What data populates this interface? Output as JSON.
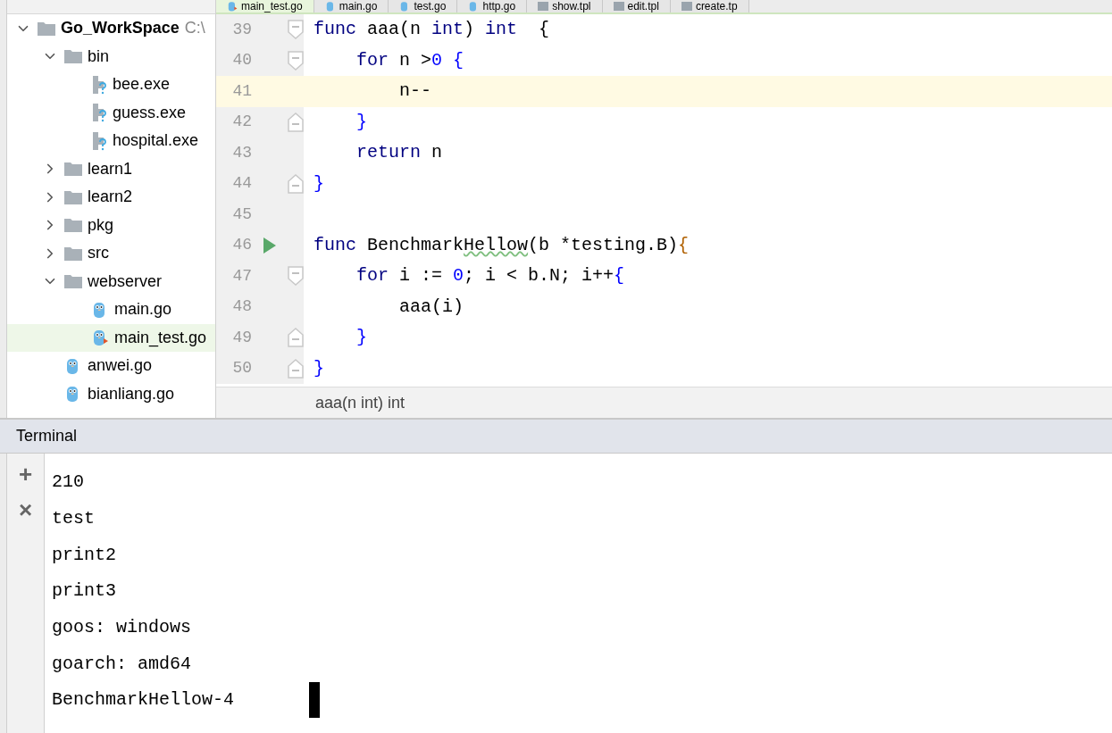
{
  "editor_tabs": [
    {
      "label": "main_test.go",
      "kind": "go_test",
      "selected": true
    },
    {
      "label": "main.go",
      "kind": "go",
      "selected": false
    },
    {
      "label": "test.go",
      "kind": "go",
      "selected": false
    },
    {
      "label": "http.go",
      "kind": "go",
      "selected": false
    },
    {
      "label": "show.tpl",
      "kind": "tpl",
      "selected": false
    },
    {
      "label": "edit.tpl",
      "kind": "tpl",
      "selected": false
    },
    {
      "label": "create.tp",
      "kind": "tpl",
      "selected": false
    }
  ],
  "project_tree": [
    {
      "label": "Go_WorkSpace",
      "path": "C:\\",
      "kind": "folder",
      "expanded": true,
      "selected": false,
      "children": [
        {
          "label": "bin",
          "kind": "folder",
          "expanded": true,
          "selected": false,
          "children": [
            {
              "label": "bee.exe",
              "kind": "exe",
              "selected": false
            },
            {
              "label": "guess.exe",
              "kind": "exe",
              "selected": false
            },
            {
              "label": "hospital.exe",
              "kind": "exe",
              "selected": false
            }
          ]
        },
        {
          "label": "learn1",
          "kind": "folder",
          "expanded": false,
          "selected": false
        },
        {
          "label": "learn2",
          "kind": "folder",
          "expanded": false,
          "selected": false
        },
        {
          "label": "pkg",
          "kind": "folder",
          "expanded": false,
          "selected": false
        },
        {
          "label": "src",
          "kind": "folder",
          "expanded": false,
          "selected": false
        },
        {
          "label": "webserver",
          "kind": "folder",
          "expanded": true,
          "selected": false,
          "children": [
            {
              "label": "main.go",
              "kind": "go",
              "selected": false
            },
            {
              "label": "main_test.go",
              "kind": "go_test",
              "selected": true
            }
          ]
        },
        {
          "label": "anwei.go",
          "kind": "go",
          "selected": false
        },
        {
          "label": "bianliang.go",
          "kind": "go",
          "selected": false
        }
      ]
    }
  ],
  "code_lines": [
    {
      "number": "39",
      "current": false,
      "run": false,
      "kind": "fold_start",
      "tokens": [
        {
          "t": "func",
          "kind": "keyword"
        },
        {
          "t": " aaa(n ",
          "kind": "plain"
        },
        {
          "t": "int",
          "kind": "keyword"
        },
        {
          "t": ") ",
          "kind": "plain"
        },
        {
          "t": "int",
          "kind": "keyword"
        },
        {
          "t": "  {",
          "kind": "plain"
        }
      ]
    },
    {
      "number": "40",
      "current": false,
      "run": false,
      "kind": "fold_start",
      "tokens": [
        {
          "t": "    for",
          "kind": "keyword"
        },
        {
          "t": " n >",
          "kind": "plain"
        },
        {
          "t": "0",
          "kind": "number"
        },
        {
          "t": " {",
          "kind": "number"
        }
      ]
    },
    {
      "number": "41",
      "current": true,
      "run": false,
      "kind": "plain",
      "tokens": [
        {
          "t": "        n--",
          "kind": "plain"
        }
      ]
    },
    {
      "number": "42",
      "current": false,
      "run": false,
      "kind": "fold_end",
      "tokens": [
        {
          "t": "    }",
          "kind": "number"
        }
      ]
    },
    {
      "number": "43",
      "current": false,
      "run": false,
      "kind": "plain",
      "tokens": [
        {
          "t": "    return",
          "kind": "keyword"
        },
        {
          "t": " n",
          "kind": "plain"
        }
      ]
    },
    {
      "number": "44",
      "current": false,
      "run": false,
      "kind": "fold_end",
      "tokens": [
        {
          "t": "}",
          "kind": "number"
        }
      ]
    },
    {
      "number": "45",
      "current": false,
      "run": false,
      "kind": "plain"
    },
    {
      "number": "46",
      "current": false,
      "run": true,
      "kind": "plain",
      "tokens": [
        {
          "t": "func",
          "kind": "keyword"
        },
        {
          "t": " Benchmark",
          "kind": "plain"
        },
        {
          "t": "Hellow",
          "kind": "typo"
        },
        {
          "t": "(b *testing.B)",
          "kind": "plain"
        },
        {
          "t": "{",
          "kind": "brace"
        }
      ]
    },
    {
      "number": "47",
      "current": false,
      "run": false,
      "kind": "fold_start",
      "tokens": [
        {
          "t": "    for",
          "kind": "keyword"
        },
        {
          "t": " i := ",
          "kind": "plain"
        },
        {
          "t": "0",
          "kind": "number"
        },
        {
          "t": "; i < b.N; i++",
          "kind": "plain"
        },
        {
          "t": "{",
          "kind": "number"
        }
      ]
    },
    {
      "number": "48",
      "current": false,
      "run": false,
      "kind": "plain",
      "tokens": [
        {
          "t": "        aaa(i)",
          "kind": "plain"
        }
      ]
    },
    {
      "number": "49",
      "current": false,
      "run": false,
      "kind": "fold_end",
      "tokens": [
        {
          "t": "    }",
          "kind": "number"
        }
      ]
    },
    {
      "number": "50",
      "current": false,
      "run": false,
      "kind": "fold_end",
      "tokens": [
        {
          "t": "}",
          "kind": "number"
        }
      ]
    }
  ],
  "breadcrumb": "aaa(n int) int",
  "terminal": {
    "title": "Terminal",
    "buttons": [
      "+",
      "×"
    ],
    "lines": [
      "210",
      "test",
      "print2",
      "print3",
      "goos: windows",
      "goarch: amd64",
      "BenchmarkHellow-4"
    ],
    "cursor": true
  }
}
